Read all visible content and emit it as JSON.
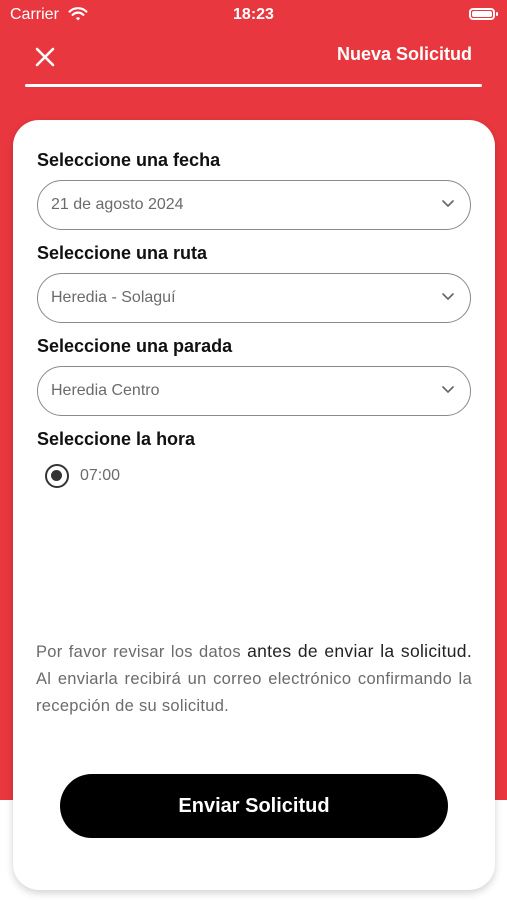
{
  "status_bar": {
    "carrier": "Carrier",
    "time": "18:23"
  },
  "header": {
    "title": "Nueva Solicitud",
    "close_icon": "close-icon"
  },
  "colors": {
    "accent": "#e9373f",
    "button": "#000000",
    "card": "#ffffff"
  },
  "form": {
    "date": {
      "label": "Seleccione una fecha",
      "value": "21 de agosto 2024"
    },
    "route": {
      "label": "Seleccione una ruta",
      "value": "Heredia - Solaguí"
    },
    "stop": {
      "label": "Seleccione una parada",
      "value": "Heredia Centro"
    },
    "time": {
      "label": "Seleccione la hora",
      "options": [
        {
          "label": "07:00",
          "selected": true
        }
      ]
    }
  },
  "notice": {
    "part1": "Por favor revisar los datos ",
    "part2": "antes de enviar la solicitud.",
    "part3": " Al enviarla recibirá un correo electrónico confirmando la recepción de su solicitud."
  },
  "submit_label": "Enviar Solicitud"
}
